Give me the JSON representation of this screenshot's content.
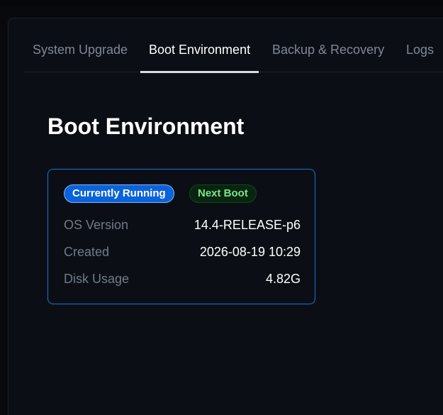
{
  "tabs": [
    {
      "label": "System Upgrade",
      "active": false
    },
    {
      "label": "Boot Environment",
      "active": true
    },
    {
      "label": "Backup & Recovery",
      "active": false
    },
    {
      "label": "Logs",
      "active": false
    }
  ],
  "page": {
    "title": "Boot Environment"
  },
  "card": {
    "badges": {
      "running": "Currently Running",
      "next": "Next Boot"
    },
    "rows": [
      {
        "label": "OS Version",
        "value": "14.4-RELEASE-p6"
      },
      {
        "label": "Created",
        "value": "2026-08-19 10:29"
      },
      {
        "label": "Disk Usage",
        "value": "4.82G"
      }
    ]
  },
  "colors": {
    "accent": "#1f72d4",
    "running_badge": "#0b63db",
    "next_badge_text": "#7fe38b",
    "background": "#0b0f15"
  }
}
